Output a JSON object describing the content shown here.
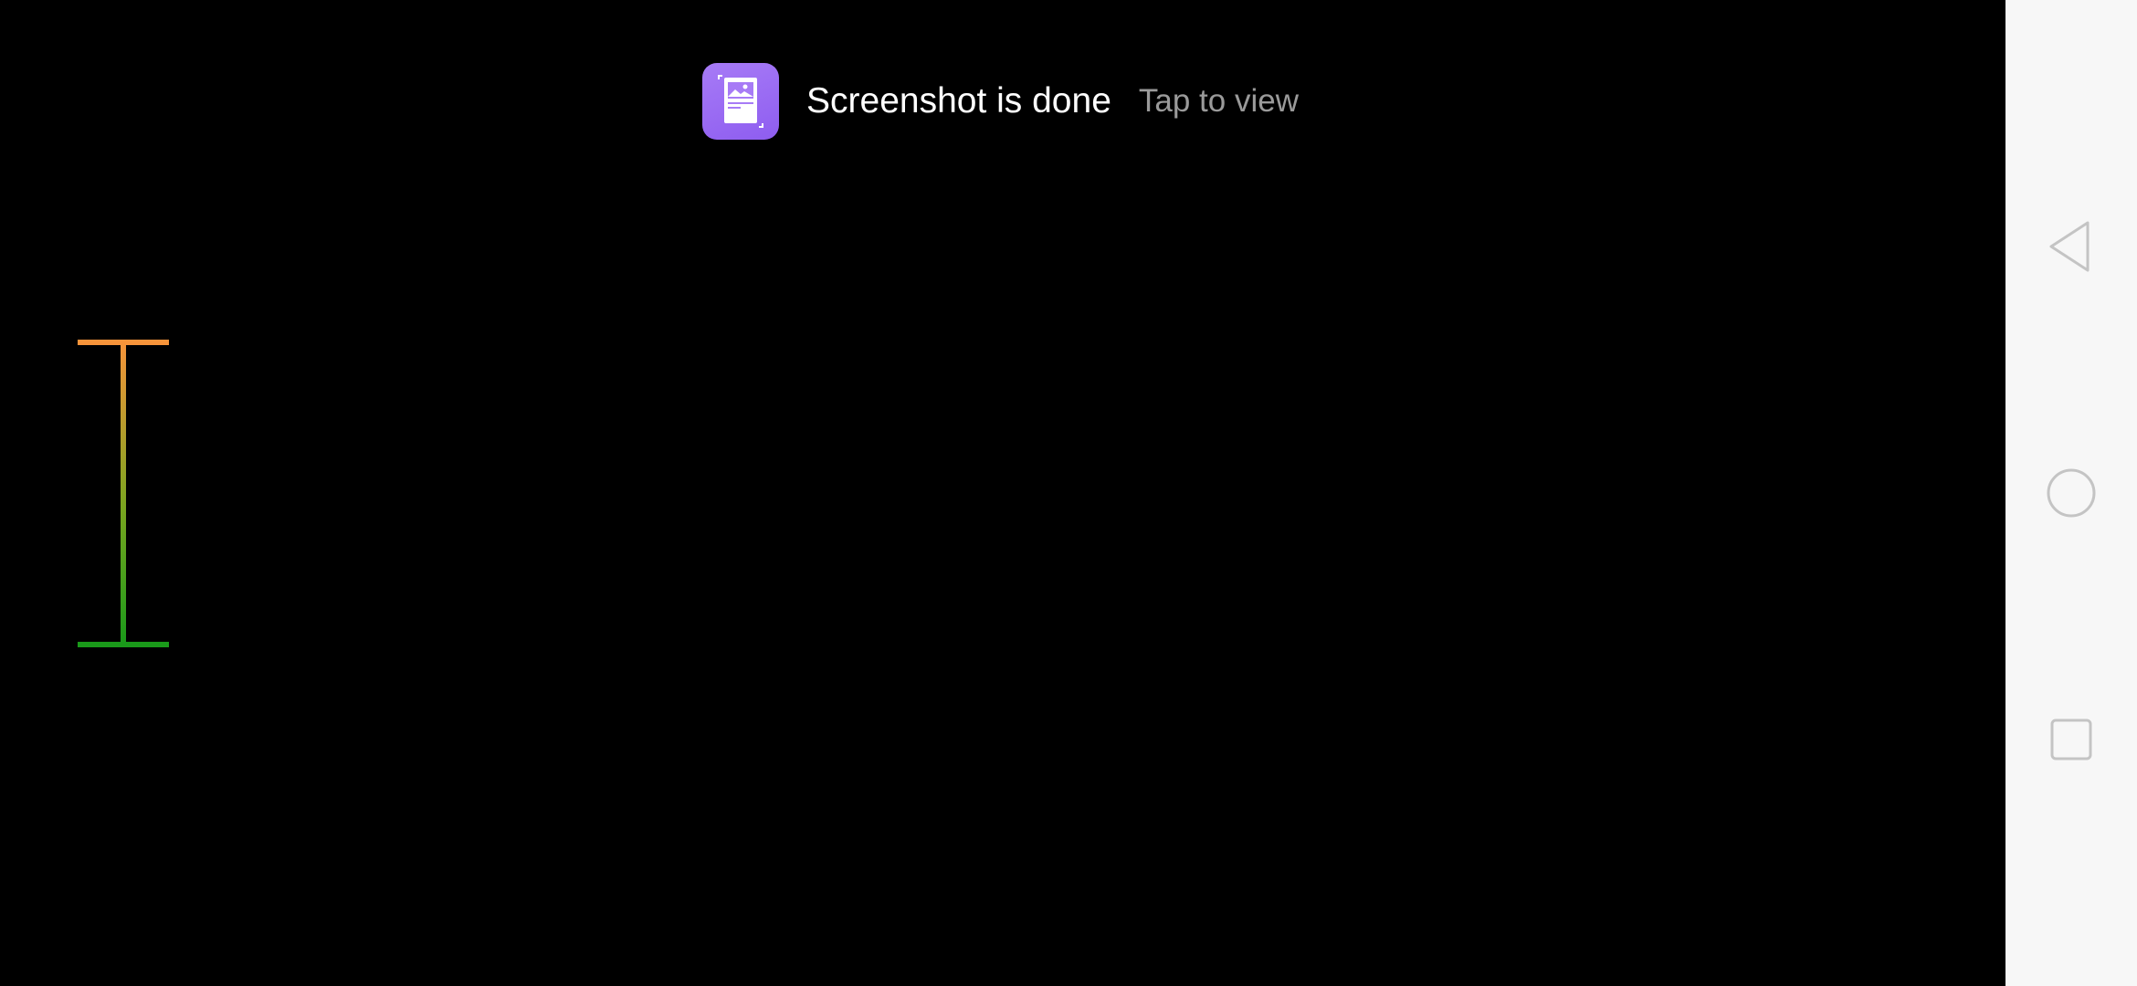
{
  "toast": {
    "title": "Screenshot is done",
    "action": "Tap to view",
    "icon": "screenshot-icon",
    "icon_color": "#9b6cf3"
  },
  "indicator": {
    "icon": "i-beam-level-icon",
    "top_color": "#f7943a",
    "bottom_color": "#1a9a1a"
  },
  "nav": {
    "back_icon": "back-triangle-icon",
    "home_icon": "home-circle-icon",
    "recents_icon": "recents-square-icon",
    "background": "#f7f7f7",
    "icon_color": "#c4c4c4"
  }
}
